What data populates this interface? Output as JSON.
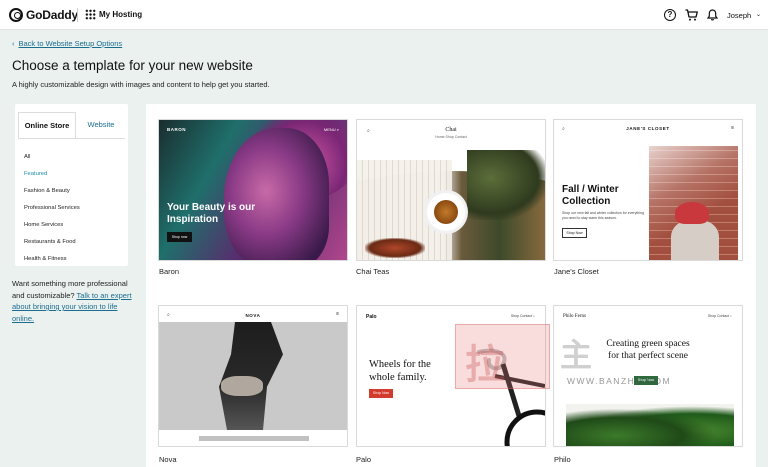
{
  "topbar": {
    "brand": "GoDaddy",
    "product": "My Hosting",
    "help_glyph": "?",
    "user": "Joseph",
    "caret": "⌄"
  },
  "header": {
    "back_link": "Back to Website Setup Options",
    "back_chevron": "‹",
    "title": "Choose a template for your new website",
    "subtitle": "A highly customizable design with images and content to help get you started."
  },
  "sidebar": {
    "tabs": [
      {
        "label": "Online Store",
        "active": true
      },
      {
        "label": "Website",
        "active": false
      }
    ],
    "categories": [
      {
        "label": "All",
        "active": false
      },
      {
        "label": "Featured",
        "active": true
      },
      {
        "label": "Fashion & Beauty",
        "active": false
      },
      {
        "label": "Professional Services",
        "active": false
      },
      {
        "label": "Home Services",
        "active": false
      },
      {
        "label": "Restaurants & Food",
        "active": false
      },
      {
        "label": "Health & Fitness",
        "active": false
      }
    ],
    "promo": {
      "text": "Want something more professional and customizable?",
      "link": "Talk to an expert about bringing your vision to life online."
    }
  },
  "templates": [
    {
      "name": "Baron",
      "preview": {
        "brand": "BARON",
        "nav": "MENU ⌕",
        "headline_1": "Your Beauty is our",
        "headline_2": "Inspiration",
        "button": "Shop now"
      }
    },
    {
      "name": "Chai Teas",
      "preview": {
        "brand": "Chai",
        "menu": "Home   Shop   Contact",
        "search": "⌕"
      }
    },
    {
      "name": "Jane's Closet",
      "preview": {
        "brand": "JANE'S CLOSET",
        "search": "⌕",
        "menu": "≡",
        "headline_1": "Fall / Winter",
        "headline_2": "Collection",
        "text": "Shop our new fall and winter collection for everything you need to stay warm this season.",
        "button": "Shop Now"
      }
    },
    {
      "name": "Nova",
      "preview": {
        "brand": "NOVA",
        "search": "⌕",
        "menu": "≡"
      }
    },
    {
      "name": "Palo",
      "preview": {
        "brand": "Palo",
        "menu": "Shop   Contact   ⌕",
        "headline_1": "Wheels for the",
        "headline_2": "whole family.",
        "button": "Shop Now"
      }
    },
    {
      "name": "Philo",
      "preview": {
        "brand": "Philo Ferns",
        "menu": "Shop   Contact   ⌕",
        "headline_1": "Creating green spaces",
        "headline_2": "for that perfect scene",
        "button": "Shop Now"
      }
    }
  ],
  "watermark": {
    "glyph_1": "拉",
    "glyph_2": "主",
    "text": "WWW.BANZHU.COM"
  },
  "colors": {
    "link": "#1b6d8f",
    "background": "#eaf1ef",
    "featured": "#1b8cae"
  }
}
